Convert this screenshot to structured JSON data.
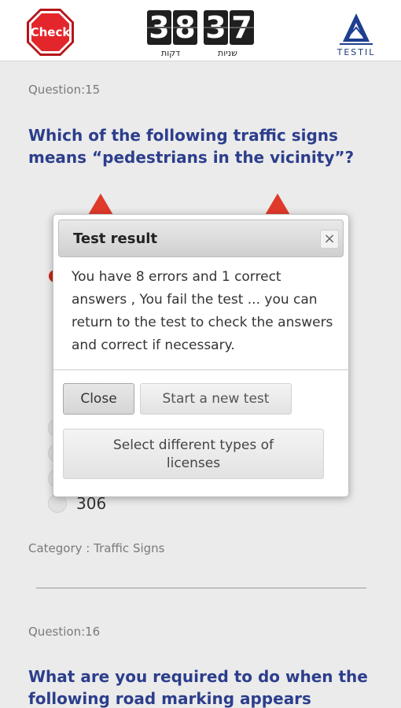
{
  "header": {
    "check_label": "Check",
    "timer": {
      "minutes_digits": [
        "3",
        "8"
      ],
      "seconds_digits": [
        "3",
        "7"
      ],
      "minutes_label": "דקות",
      "seconds_label": "שניות"
    },
    "logo_text": "TESTIL"
  },
  "question_15": {
    "number_label": "Question:15",
    "text": "Which of the following traffic signs means “pedestrians in the vicinity”?",
    "last_option_label": "306",
    "category": "Category : Traffic Signs"
  },
  "question_16": {
    "number_label": "Question:16",
    "text": "What are you required to do when the following road marking appears"
  },
  "dialog": {
    "title": "Test result",
    "close_icon": "×",
    "message": "You have 8 errors and 1 correct answers , You fail the test ... you can return to the test to check the answers and correct if necessary.",
    "close_button": "Close",
    "new_test_button": "Start a new test",
    "licenses_button": "Select different types of licenses"
  },
  "colors": {
    "question_text": "#2c3e8c",
    "stop_sign": "#e3262c",
    "sign_triangle": "#e03a2a"
  }
}
